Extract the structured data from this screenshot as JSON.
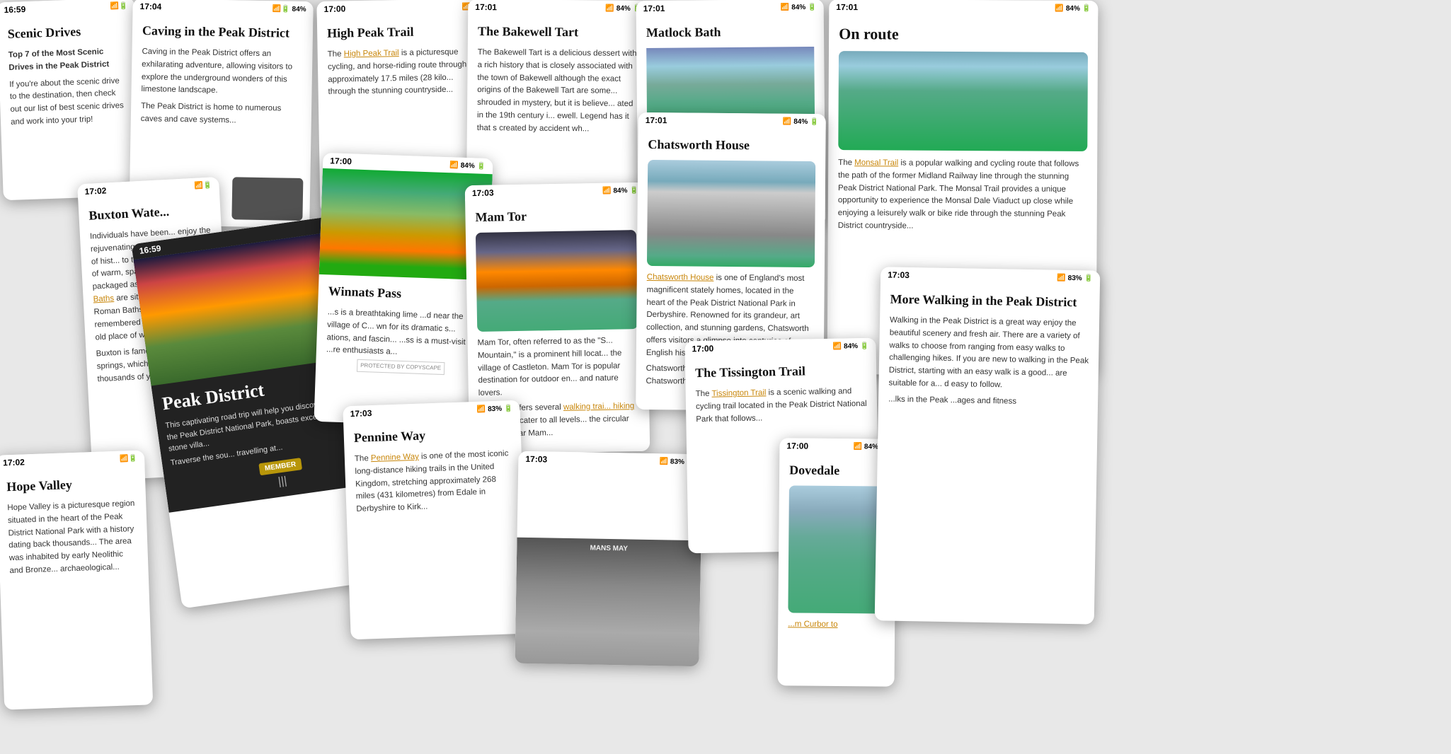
{
  "cards": {
    "scenic": {
      "time": "16:59",
      "title": "Scenic Drives",
      "subtitle": "Top 7 of the Most Scenic Drives in the Peak District",
      "body": "If you're about the scenic drive to the destination, then check out our list of best scenic drives and work into your trip!"
    },
    "caving": {
      "time": "17:04",
      "status": "84%",
      "title": "Caving in the Peak District",
      "body": "Caving in the Peak District offers an exhilarating adventure, allowing visitors to explore the underground wonders of this limestone landscape.",
      "body2": "The Peak District is home to numerous caves and cave systems..."
    },
    "highpeak": {
      "time": "17:00",
      "title": "High Peak Trail",
      "body_pre": "The ",
      "link": "High Peak Trail",
      "body": " is a picturesque cycling, and horse-riding route through approximately 17.5 miles (28 kilo... through the stunning countryside..."
    },
    "bakewell": {
      "time": "17:01",
      "status": "84%",
      "title": "The Bakewell Tart",
      "body": "The Bakewell Tart is a delicious dessert with a rich history that is closely associated with the town of Bakewell although the exact origins of the Bakewell Tart are some... shrouded in mystery, but it is believe... ated in the 19th century i... ewell. Legend has it that s created by accident wh..."
    },
    "matlock": {
      "time": "17:01",
      "status": "84%",
      "title": "Matlock Bath"
    },
    "onroute": {
      "time": "17:01",
      "status": "84%",
      "title": "On route",
      "body_pre": "The ",
      "link": "Monsal Trail",
      "body": " is a popular walking and cycling route that follows the path of the former Midland Railway line through the stunning Peak District National Park. The Monsal Trail provides a unique opportunity to experience the Monsal Dale Viaduct up close while enjoying a leisurely walk or bike ride through the stunning Peak District countryside..."
    },
    "buxton": {
      "time": "17:02",
      "title": "Buxton Wate...",
      "body": "Individuals have been... enjoy the rejuvenating... There is quite a bit of hist... to the healing properties of warm, spa waters, known t... packaged as ",
      "link": "Buxton Wate... Baths",
      "body2": " are situated on the s... Roman Baths which are th... remembered to be situate... an old place of worship.",
      "body3": "Buxton is famous for its nat... springs, which have been... thousands of year... the grou..."
    },
    "peakdistrict": {
      "time": "16:59",
      "title": "Peak District",
      "body": "This captivating road trip will help you discover the beauty of the Peak District National Park, boasts exceptional view... stone villa...",
      "body2": "Traverse the sou... travelling at..."
    },
    "winnats": {
      "time": "17:00",
      "status": "84%",
      "title": "Winnats Pass",
      "body": "...s is a breathtaking lime ...d near the village of C... wn for its dramatic s... ations, and fascin... ...ss is a must-visit ...re enthusiasts a..."
    },
    "mamtor": {
      "time": "17:03",
      "status": "84%",
      "title": "Mam Tor",
      "body": "Mam Tor, often referred to as the \"S... Mountain,\" is a prominent hill locat... the village of Castleton. Mam Tor is popular destination for outdoor en... and nature lovers.",
      "body2": "Mam Tor offers several ",
      "link": "walking trai... hiking routes",
      "body3": " that cater to all levels... the circular v... park near Mam..."
    },
    "chatsworth": {
      "time": "17:01",
      "status": "84%",
      "title": "Chatsworth House",
      "link": "Chatsworth House",
      "body": " is one of England's most magnificent stately homes, located in the heart of the Peak District National Park in Derbyshire. Renowned for its grandeur, art collection, and stunning gardens, Chatsworth offers visitors a glimpse into centuries of English history and aristocratic life.",
      "body2": "Chatsworths... Duchess o... Cavendish... Chatsworths... 16th centu..."
    },
    "hopeval": {
      "time": "17:02",
      "title": "Hope Valley",
      "body": "Hope Valley is a picturesque region situated in the heart of the Peak District National Park with a history dating back thousands... The area was inhabited by early Neolithic and Bronze... archaeological..."
    },
    "pennine": {
      "time": "17:03",
      "status": "83%",
      "title": "Pennine Way",
      "body_pre": "The ",
      "link": "Pennine Way",
      "body": " is one of the most iconic long-distance hiking trails in the United Kingdom, stretching approximately 268 miles (431 kilometres) from Edale in Derbyshire to Kirk..."
    },
    "mamtor2": {
      "time": "17:03",
      "status": "83%"
    },
    "tissington": {
      "time": "17:00",
      "status": "84%",
      "title": "The Tissington Trail",
      "body_pre": "The ",
      "link": "Tissington Trail",
      "body": " is a scenic walking and cycling trail located in the Peak District National Park that follows..."
    },
    "dovedale": {
      "time": "17:00",
      "status": "84%",
      "title": "Dovedale",
      "link": "...m Curbor to"
    },
    "morewalk": {
      "time": "17:03",
      "status": "83%",
      "title": "More Walking in the Peak District",
      "body": "Walking in the Peak District is a great way enjoy the beautiful scenery and fresh air. There are a variety of walks to choose from ranging from easy walks to challenging hikes. If you are new to walking in the Peak District, starting with an easy walk is a good... are suitable for a... d easy to follow.",
      "body2": "...lks in the Peak ...ages and fitness"
    },
    "member": "MEMBER",
    "watermark": "PROTECTED BY COPYSCAPE"
  }
}
